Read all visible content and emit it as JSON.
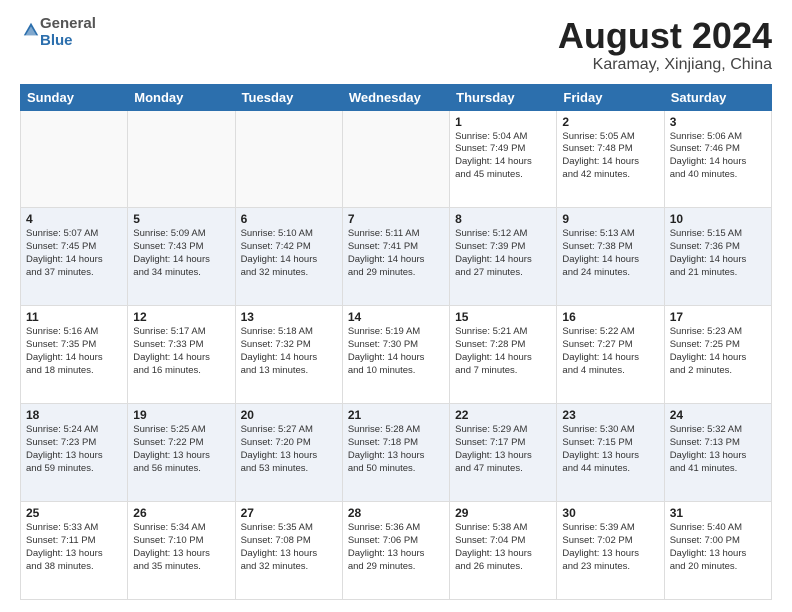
{
  "header": {
    "logo_general": "General",
    "logo_blue": "Blue",
    "month_title": "August 2024",
    "subtitle": "Karamay, Xinjiang, China"
  },
  "days_of_week": [
    "Sunday",
    "Monday",
    "Tuesday",
    "Wednesday",
    "Thursday",
    "Friday",
    "Saturday"
  ],
  "weeks": [
    [
      {
        "day": "",
        "info": ""
      },
      {
        "day": "",
        "info": ""
      },
      {
        "day": "",
        "info": ""
      },
      {
        "day": "",
        "info": ""
      },
      {
        "day": "1",
        "info": "Sunrise: 5:04 AM\nSunset: 7:49 PM\nDaylight: 14 hours\nand 45 minutes."
      },
      {
        "day": "2",
        "info": "Sunrise: 5:05 AM\nSunset: 7:48 PM\nDaylight: 14 hours\nand 42 minutes."
      },
      {
        "day": "3",
        "info": "Sunrise: 5:06 AM\nSunset: 7:46 PM\nDaylight: 14 hours\nand 40 minutes."
      }
    ],
    [
      {
        "day": "4",
        "info": "Sunrise: 5:07 AM\nSunset: 7:45 PM\nDaylight: 14 hours\nand 37 minutes."
      },
      {
        "day": "5",
        "info": "Sunrise: 5:09 AM\nSunset: 7:43 PM\nDaylight: 14 hours\nand 34 minutes."
      },
      {
        "day": "6",
        "info": "Sunrise: 5:10 AM\nSunset: 7:42 PM\nDaylight: 14 hours\nand 32 minutes."
      },
      {
        "day": "7",
        "info": "Sunrise: 5:11 AM\nSunset: 7:41 PM\nDaylight: 14 hours\nand 29 minutes."
      },
      {
        "day": "8",
        "info": "Sunrise: 5:12 AM\nSunset: 7:39 PM\nDaylight: 14 hours\nand 27 minutes."
      },
      {
        "day": "9",
        "info": "Sunrise: 5:13 AM\nSunset: 7:38 PM\nDaylight: 14 hours\nand 24 minutes."
      },
      {
        "day": "10",
        "info": "Sunrise: 5:15 AM\nSunset: 7:36 PM\nDaylight: 14 hours\nand 21 minutes."
      }
    ],
    [
      {
        "day": "11",
        "info": "Sunrise: 5:16 AM\nSunset: 7:35 PM\nDaylight: 14 hours\nand 18 minutes."
      },
      {
        "day": "12",
        "info": "Sunrise: 5:17 AM\nSunset: 7:33 PM\nDaylight: 14 hours\nand 16 minutes."
      },
      {
        "day": "13",
        "info": "Sunrise: 5:18 AM\nSunset: 7:32 PM\nDaylight: 14 hours\nand 13 minutes."
      },
      {
        "day": "14",
        "info": "Sunrise: 5:19 AM\nSunset: 7:30 PM\nDaylight: 14 hours\nand 10 minutes."
      },
      {
        "day": "15",
        "info": "Sunrise: 5:21 AM\nSunset: 7:28 PM\nDaylight: 14 hours\nand 7 minutes."
      },
      {
        "day": "16",
        "info": "Sunrise: 5:22 AM\nSunset: 7:27 PM\nDaylight: 14 hours\nand 4 minutes."
      },
      {
        "day": "17",
        "info": "Sunrise: 5:23 AM\nSunset: 7:25 PM\nDaylight: 14 hours\nand 2 minutes."
      }
    ],
    [
      {
        "day": "18",
        "info": "Sunrise: 5:24 AM\nSunset: 7:23 PM\nDaylight: 13 hours\nand 59 minutes."
      },
      {
        "day": "19",
        "info": "Sunrise: 5:25 AM\nSunset: 7:22 PM\nDaylight: 13 hours\nand 56 minutes."
      },
      {
        "day": "20",
        "info": "Sunrise: 5:27 AM\nSunset: 7:20 PM\nDaylight: 13 hours\nand 53 minutes."
      },
      {
        "day": "21",
        "info": "Sunrise: 5:28 AM\nSunset: 7:18 PM\nDaylight: 13 hours\nand 50 minutes."
      },
      {
        "day": "22",
        "info": "Sunrise: 5:29 AM\nSunset: 7:17 PM\nDaylight: 13 hours\nand 47 minutes."
      },
      {
        "day": "23",
        "info": "Sunrise: 5:30 AM\nSunset: 7:15 PM\nDaylight: 13 hours\nand 44 minutes."
      },
      {
        "day": "24",
        "info": "Sunrise: 5:32 AM\nSunset: 7:13 PM\nDaylight: 13 hours\nand 41 minutes."
      }
    ],
    [
      {
        "day": "25",
        "info": "Sunrise: 5:33 AM\nSunset: 7:11 PM\nDaylight: 13 hours\nand 38 minutes."
      },
      {
        "day": "26",
        "info": "Sunrise: 5:34 AM\nSunset: 7:10 PM\nDaylight: 13 hours\nand 35 minutes."
      },
      {
        "day": "27",
        "info": "Sunrise: 5:35 AM\nSunset: 7:08 PM\nDaylight: 13 hours\nand 32 minutes."
      },
      {
        "day": "28",
        "info": "Sunrise: 5:36 AM\nSunset: 7:06 PM\nDaylight: 13 hours\nand 29 minutes."
      },
      {
        "day": "29",
        "info": "Sunrise: 5:38 AM\nSunset: 7:04 PM\nDaylight: 13 hours\nand 26 minutes."
      },
      {
        "day": "30",
        "info": "Sunrise: 5:39 AM\nSunset: 7:02 PM\nDaylight: 13 hours\nand 23 minutes."
      },
      {
        "day": "31",
        "info": "Sunrise: 5:40 AM\nSunset: 7:00 PM\nDaylight: 13 hours\nand 20 minutes."
      }
    ]
  ]
}
